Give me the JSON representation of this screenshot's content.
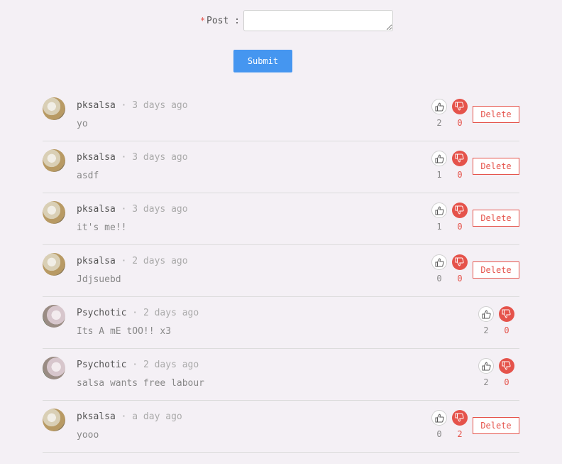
{
  "form": {
    "required_mark": "*",
    "post_label": "Post :",
    "post_value": "",
    "submit_label": "Submit"
  },
  "colors": {
    "accent": "#4596f0",
    "danger": "#e5534b",
    "background": "#f4f0f5"
  },
  "comments": [
    {
      "author": "pksalsa",
      "time": "3 days ago",
      "text": "yo",
      "likes": "2",
      "dislikes": "0",
      "delete_label": "Delete",
      "avatar": "pksalsa-avatar"
    },
    {
      "author": "pksalsa",
      "time": "3 days ago",
      "text": "asdf",
      "likes": "1",
      "dislikes": "0",
      "delete_label": "Delete",
      "avatar": "pksalsa-avatar"
    },
    {
      "author": "pksalsa",
      "time": "3 days ago",
      "text": "it's me!!",
      "likes": "1",
      "dislikes": "0",
      "delete_label": "Delete",
      "avatar": "pksalsa-avatar"
    },
    {
      "author": "pksalsa",
      "time": "2 days ago",
      "text": "Jdjsuebd",
      "likes": "0",
      "dislikes": "0",
      "delete_label": "Delete",
      "avatar": "pksalsa-avatar"
    },
    {
      "author": "Psychotic",
      "time": "2 days ago",
      "text": "Its A mE tOO!! x3",
      "likes": "2",
      "dislikes": "0",
      "delete_label": null,
      "avatar": "psychotic-avatar"
    },
    {
      "author": "Psychotic",
      "time": "2 days ago",
      "text": "salsa wants free labour",
      "likes": "2",
      "dislikes": "0",
      "delete_label": null,
      "avatar": "psychotic-avatar"
    },
    {
      "author": "pksalsa",
      "time": "a day ago",
      "text": "yooo",
      "likes": "0",
      "dislikes": "2",
      "delete_label": "Delete",
      "avatar": "pksalsa-avatar"
    }
  ],
  "separator": "·",
  "icons": {
    "like": "thumbs-up-icon",
    "dislike": "thumbs-down-icon"
  }
}
